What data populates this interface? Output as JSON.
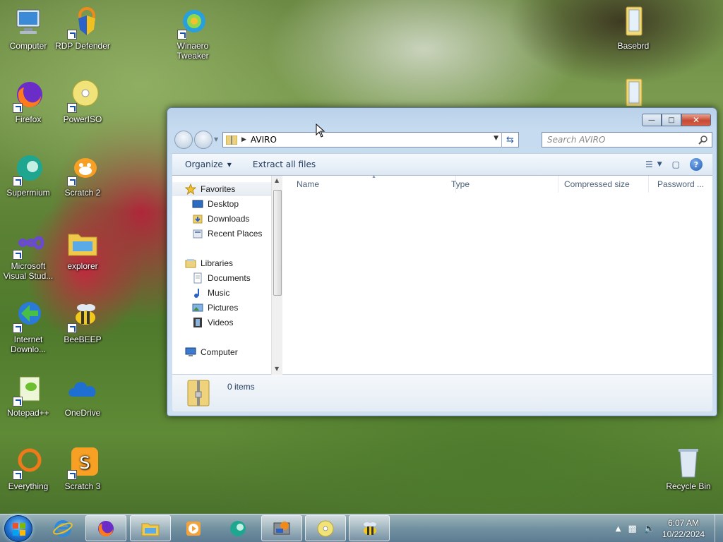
{
  "desktop": {
    "icons": [
      {
        "label": "Computer"
      },
      {
        "label": "RDP Defender"
      },
      {
        "label": "Winaero Tweaker"
      },
      {
        "label": "Basebrd"
      },
      {
        "label": "Firefox"
      },
      {
        "label": "PowerISO"
      },
      {
        "label": "Supermium"
      },
      {
        "label": "Scratch 2"
      },
      {
        "label": "Microsoft Visual Stud..."
      },
      {
        "label": "explorer"
      },
      {
        "label": "Internet Downlo..."
      },
      {
        "label": "BeeBEEP"
      },
      {
        "label": "Notepad++"
      },
      {
        "label": "OneDrive"
      },
      {
        "label": "Everything"
      },
      {
        "label": "Scratch 3"
      },
      {
        "label": "Recycle Bin"
      }
    ]
  },
  "window": {
    "address": "AVIRO",
    "search_placeholder": "Search AVIRO",
    "toolbar": {
      "organize": "Organize",
      "extract": "Extract all files"
    },
    "nav": {
      "favorites": "Favorites",
      "desktop": "Desktop",
      "downloads": "Downloads",
      "recent": "Recent Places",
      "libraries": "Libraries",
      "documents": "Documents",
      "music": "Music",
      "pictures": "Pictures",
      "videos": "Videos",
      "computer": "Computer"
    },
    "columns": {
      "name": "Name",
      "type": "Type",
      "compressed": "Compressed size",
      "password": "Password ..."
    },
    "status": "0 items"
  },
  "taskbar": {
    "time": "6:07 AM",
    "date": "10/22/2024"
  },
  "colors": {
    "window_frame": "#c6dbef",
    "taskbar": "#7896b4",
    "accent": "#1e395b"
  }
}
